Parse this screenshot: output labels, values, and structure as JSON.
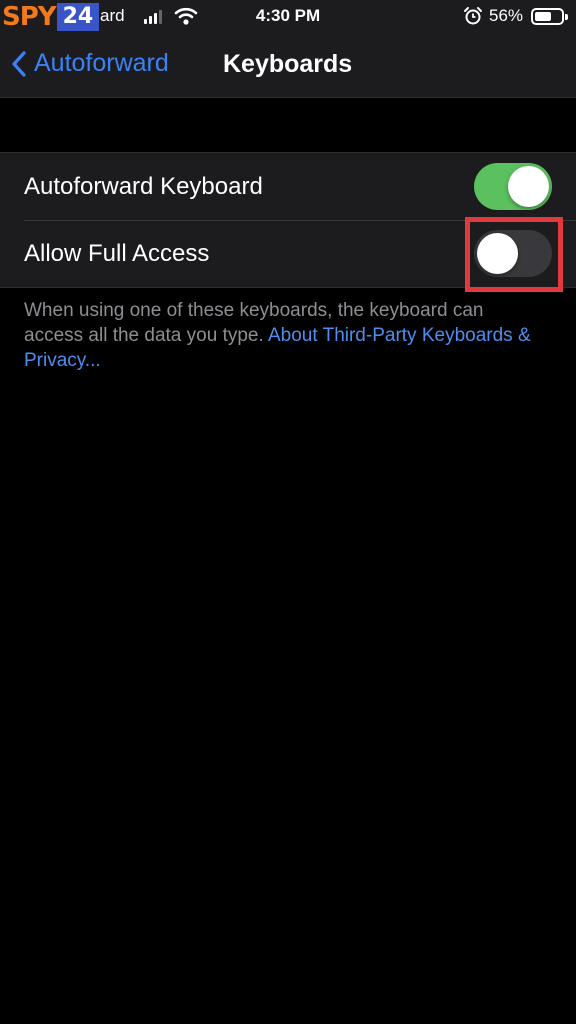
{
  "status_bar": {
    "watermark_spy": "SPY",
    "watermark_24": "24",
    "carrier": "ard",
    "time": "4:30 PM",
    "battery_percent": "56%",
    "battery_level": 0.56,
    "icons": [
      "signal-icon",
      "wifi-icon",
      "alarm-icon",
      "battery-icon"
    ]
  },
  "nav": {
    "back_label": "Autoforward",
    "title": "Keyboards",
    "accent_color": "#3b82f6"
  },
  "settings": {
    "rows": [
      {
        "label": "Autoforward Keyboard",
        "toggle": true
      },
      {
        "label": "Allow Full Access",
        "toggle": false
      }
    ],
    "toggle_on_color": "#5ac15e",
    "highlight_color": "#e03a3f"
  },
  "footer": {
    "text": "When using one of these keyboards, the keyboard can access all the data you type. ",
    "link": "About Third-Party Keyboards & Privacy..."
  }
}
